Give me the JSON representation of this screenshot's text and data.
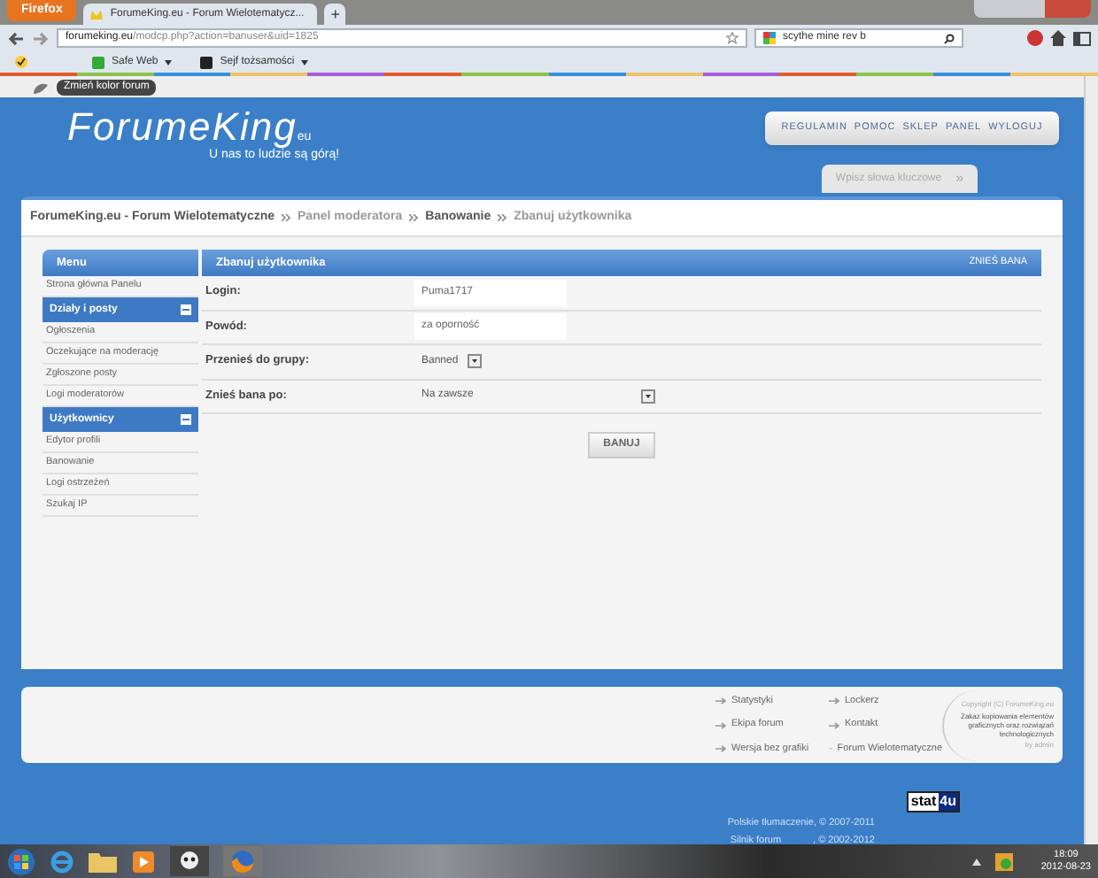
{
  "browser": {
    "menu_button": "Firefox",
    "tabs": [
      {
        "label": "ForumeKing.eu - Forum Wielotematycz...",
        "selected": true
      }
    ],
    "new_tab": "+",
    "url": {
      "domain": "forumeking.eu",
      "path": "/modcp.php?action=banuser&uid=1825"
    },
    "search": {
      "value": "scythe mine rev b"
    },
    "bookmarks": [
      "Safe Web",
      "Sejf tożsamości"
    ]
  },
  "tooltip": "Zmień kolor forum",
  "header": {
    "logo": "ForumeKing",
    "logo_suffix": "eu",
    "slogan": "U nas to ludzie są górą!",
    "nav": [
      "REGULAMIN",
      "POMOC",
      "SKLEP",
      "PANEL",
      "WYLOGUJ"
    ],
    "search_placeholder": "Wpisz słowa kluczowe",
    "search_go": "»"
  },
  "breadcrumb": [
    {
      "label": "ForumeKing.eu - Forum Wielotematyczne",
      "bold": true
    },
    {
      "label": "Panel moderatora",
      "bold": false
    },
    {
      "label": "Banowanie",
      "bold": true
    },
    {
      "label": "Zbanuj użytkownika",
      "bold": false
    }
  ],
  "sidebar": {
    "title": "Menu",
    "items": [
      {
        "kind": "link",
        "label": "Strona główna Panelu"
      },
      {
        "kind": "section",
        "label": "Działy i posty",
        "expanded": true
      },
      {
        "kind": "link",
        "label": "Ogłoszenia"
      },
      {
        "kind": "link",
        "label": "Oczekujące na moderację"
      },
      {
        "kind": "link",
        "label": "Zgłoszone posty"
      },
      {
        "kind": "link",
        "label": "Logi moderatorów"
      },
      {
        "kind": "section",
        "label": "Użytkownicy",
        "expanded": true
      },
      {
        "kind": "link",
        "label": "Edytor profili"
      },
      {
        "kind": "link",
        "label": "Banowanie"
      },
      {
        "kind": "link",
        "label": "Logi ostrzeżeń"
      },
      {
        "kind": "link",
        "label": "Szukaj IP"
      }
    ]
  },
  "form": {
    "title": "Zbanuj użytkownika",
    "action": "ZNIEŚ BANA",
    "rows": [
      {
        "kind": "text",
        "label": "Login:",
        "value": "Puma1717"
      },
      {
        "kind": "text",
        "label": "Powód:",
        "value": "za oporność"
      },
      {
        "kind": "select",
        "label": "Przenieś do grupy:",
        "value": "Banned"
      },
      {
        "kind": "select",
        "label": "Znieś bana po:",
        "value": "Na zawsze"
      }
    ],
    "submit": "BANUJ"
  },
  "footer": {
    "links": [
      "Statystyki",
      "Lockerz",
      "Ekipa forum",
      "Kontakt",
      "Wersja bez grafiki",
      "Forum Wielotematyczne"
    ],
    "copyright": [
      "Copyright (C) ForumeKing.eu",
      "Zakaz kopiowania elementów graficznych oraz rozwiązań technologicznych",
      "by admin"
    ],
    "counter": [
      "stat",
      "4u"
    ],
    "credits": [
      "Polskie tłumaczenie, © 2007-2011",
      "Silnik forum",
      ", © 2002-2012"
    ]
  },
  "taskbar": {
    "time": "18:09",
    "date": "2012-08-23"
  }
}
